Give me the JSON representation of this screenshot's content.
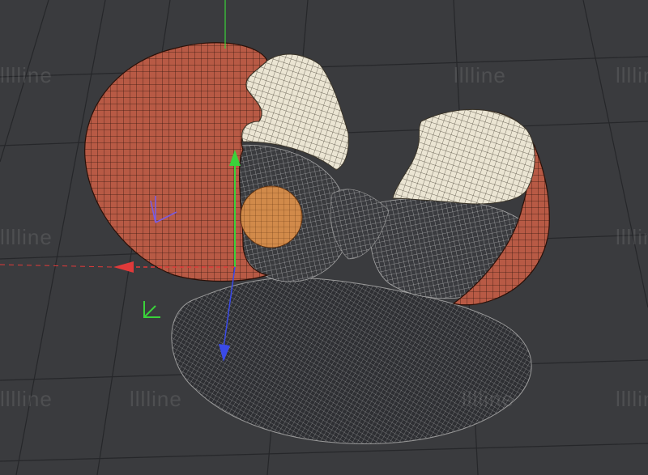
{
  "viewport": {
    "name": "3D viewport",
    "background": "#3a3b3e",
    "grid_color": "#26272a",
    "watermark_text": "lllline"
  },
  "scene": {
    "objects": [
      {
        "name": "cracked-eggshell-left",
        "shell_color": "#b85a45",
        "inner_color": "#e8e2d0"
      },
      {
        "name": "egg-yolk",
        "color": "#d18a4a"
      },
      {
        "name": "cracked-eggshell-right",
        "shell_color": "#b55a40",
        "inner_color": "#e8e2d0"
      },
      {
        "name": "egg-white-puddle",
        "color": "#2e2f33",
        "wire_color": "#c8c8c8"
      }
    ]
  },
  "gizmo": {
    "x_color": "#e03a3a",
    "y_color": "#3ad23a",
    "z_color": "#3a4ae8",
    "local_axes_color": "#7a5ce0"
  }
}
